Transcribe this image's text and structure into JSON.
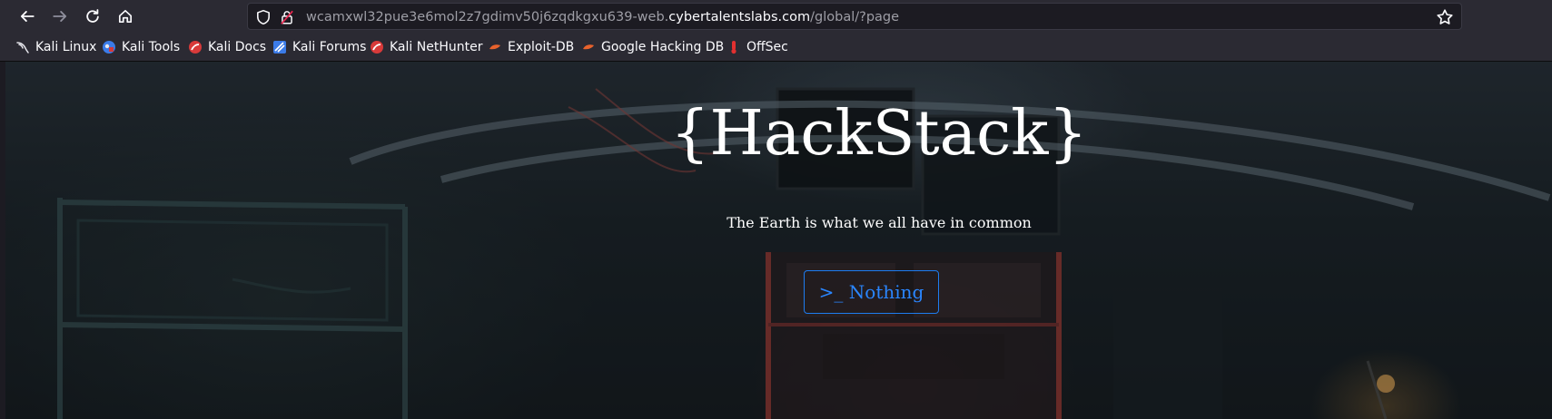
{
  "browser": {
    "url_prefix": "wcamxwl32pue3e6mol2z7gdimv50j6zqdkgxu639-web.",
    "url_domain": "cybertalentslabs.com",
    "url_path": "/global/?page",
    "icons": {
      "back": "arrow-left-icon",
      "forward": "arrow-right-icon",
      "reload": "reload-icon",
      "home": "home-icon",
      "shield": "shield-icon",
      "lock": "lock-insecure-icon",
      "star": "star-icon"
    }
  },
  "bookmarks": [
    {
      "label": "Kali Linux",
      "icon": "kali-dragon-icon"
    },
    {
      "label": "Kali Tools",
      "icon": "kali-tools-icon"
    },
    {
      "label": "Kali Docs",
      "icon": "kali-docs-icon"
    },
    {
      "label": "Kali Forums",
      "icon": "kali-forums-icon"
    },
    {
      "label": "Kali NetHunter",
      "icon": "kali-nethunter-icon"
    },
    {
      "label": "Exploit-DB",
      "icon": "exploit-db-icon"
    },
    {
      "label": "Google Hacking DB",
      "icon": "ghdb-icon"
    },
    {
      "label": "OffSec",
      "icon": "offsec-icon"
    }
  ],
  "hero": {
    "title": "{HackStack}",
    "tagline": "The Earth is what we all have in common",
    "button_label": ">_ Nothing"
  },
  "colors": {
    "toolbar_bg": "#2b2a33",
    "url_bg": "#1c1b22",
    "accent": "#2a86ff"
  }
}
